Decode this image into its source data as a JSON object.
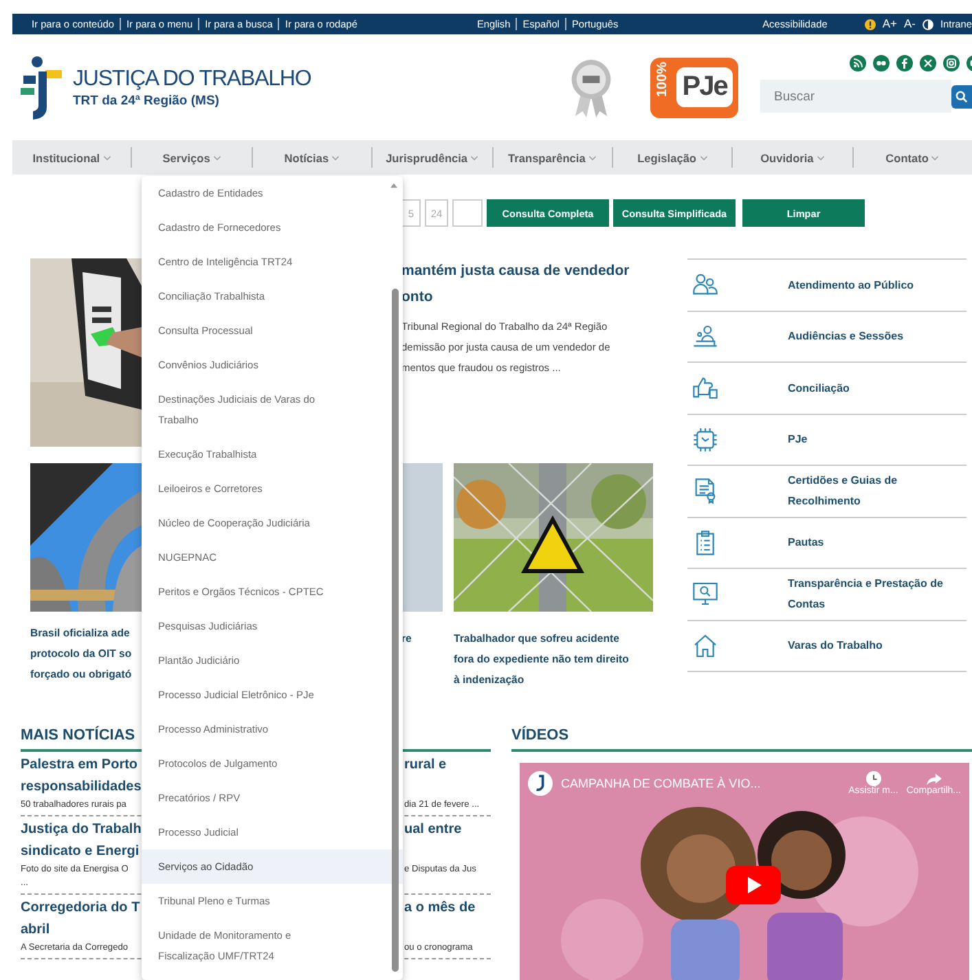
{
  "top_bar": {
    "skip_links": [
      "Ir para o conteúdo",
      "Ir para o menu",
      "Ir para a busca",
      "Ir para o rodapé"
    ],
    "languages": [
      "English",
      "Español",
      "Português"
    ],
    "accessibility": "Acessibilidade",
    "font_controls": [
      "A+",
      "A-"
    ],
    "intranet": "Intrane"
  },
  "header": {
    "title": "JUSTIÇA DO TRABALHO",
    "subtitle": "TRT da 24ª Região (MS)",
    "pje_badge": {
      "percent": "100%",
      "label": "PJe"
    },
    "search": {
      "placeholder": "Buscar"
    }
  },
  "nav": [
    {
      "label": "Institucional"
    },
    {
      "label": "Serviços"
    },
    {
      "label": "Notícias"
    },
    {
      "label": "Jurisprudência"
    },
    {
      "label": "Transparência"
    },
    {
      "label": "Legislação"
    },
    {
      "label": "Ouvidoria"
    },
    {
      "label": "Contato"
    }
  ],
  "services_menu": [
    {
      "label": "Cadastro de Entidades",
      "selected": false
    },
    {
      "label": "Cadastro de Fornecedores",
      "selected": false
    },
    {
      "label": "Centro de Inteligência TRT24",
      "selected": false
    },
    {
      "label": "Conciliação Trabalhista",
      "selected": false
    },
    {
      "label": "Consulta Processual",
      "selected": false
    },
    {
      "label": "Convênios Judiciários",
      "selected": false
    },
    {
      "label": "Destinações Judiciais de Varas do Trabalho",
      "selected": false
    },
    {
      "label": "Execução Trabalhista",
      "selected": false
    },
    {
      "label": "Leiloeiros e Corretores",
      "selected": false
    },
    {
      "label": "Núcleo de Cooperação Judiciária",
      "selected": false
    },
    {
      "label": "NUGEPNAC",
      "selected": false
    },
    {
      "label": "Peritos e Orgãos Técnicos - CPTEC",
      "selected": false
    },
    {
      "label": "Pesquisas Judiciárias",
      "selected": false
    },
    {
      "label": "Plantão Judiciário",
      "selected": false
    },
    {
      "label": "Processo Judicial Eletrônico - PJe",
      "selected": false
    },
    {
      "label": "Processo Administrativo",
      "selected": false
    },
    {
      "label": "Protocolos de Julgamento",
      "selected": false
    },
    {
      "label": "Precatórios / RPV",
      "selected": false
    },
    {
      "label": "Processo Judicial",
      "selected": false
    },
    {
      "label": "Serviços ao Cidadão",
      "selected": true
    },
    {
      "label": "Tribunal Pleno e Turmas",
      "selected": false
    },
    {
      "label": "Unidade de Monitoramento e Fiscalização UMF/TRT24",
      "selected": false
    }
  ],
  "process_search": {
    "fields": [
      "5",
      "24"
    ],
    "buttons": [
      "Consulta Completa",
      "Consulta Simplificada",
      "Limpar"
    ]
  },
  "featured_story": {
    "headline_lines": [
      "mantém justa causa de vendedor",
      "onto"
    ],
    "excerpt_lines": [
      "Tribunal Regional do Trabalho da 24ª Região",
      "demissão por justa causa de um vendedor de",
      "mentos que fraudou os registros ..."
    ]
  },
  "story_cards": {
    "left_caption_lines": [
      "Brasil oficializa ade",
      "protocolo da OIT so",
      "forçado ou obrigató"
    ],
    "middle_caption": "re",
    "right_caption_lines": [
      "Trabalhador que sofreu acidente",
      "fora do expediente não tem direito",
      "à indenização"
    ]
  },
  "services": [
    {
      "label": "Atendimento ao Público"
    },
    {
      "label": "Audiências e Sessões"
    },
    {
      "label": "Conciliação"
    },
    {
      "label": "PJe"
    },
    {
      "label": "Certidões e Guias de Recolhimento"
    },
    {
      "label": "Pautas"
    },
    {
      "label": "Transparência e Prestação de Contas"
    },
    {
      "label": "Varas do Trabalho"
    }
  ],
  "more_news": {
    "heading": "MAIS NOTÍCIAS",
    "items": [
      {
        "title_left": [
          "Palestra em Porto",
          "responsabilidades"
        ],
        "title_right": [
          "rural e"
        ],
        "excerpt_left": [
          "50 trabalhadores rurais pa"
        ],
        "excerpt_right": [
          "dia 21 de fevere ..."
        ]
      },
      {
        "title_left": [
          "Justiça do Trabalh",
          "sindicato e Energi"
        ],
        "title_right": [
          "ual entre"
        ],
        "excerpt_left": [
          "Foto do site da Energisa O",
          "..."
        ],
        "excerpt_right": [
          "e Disputas da Jus"
        ]
      },
      {
        "title_left": [
          "Corregedoria do T",
          "abril"
        ],
        "title_right": [
          "a o mês de"
        ],
        "excerpt_left": [
          "A Secretaria da Corregedo"
        ],
        "excerpt_right": [
          "ou o cronograma"
        ]
      }
    ]
  },
  "videos": {
    "heading": "VÍDEOS",
    "title": "CAMPANHA DE COMBATE À VIO...",
    "watch_later": "Assistir m...",
    "share": "Compartilh..."
  }
}
